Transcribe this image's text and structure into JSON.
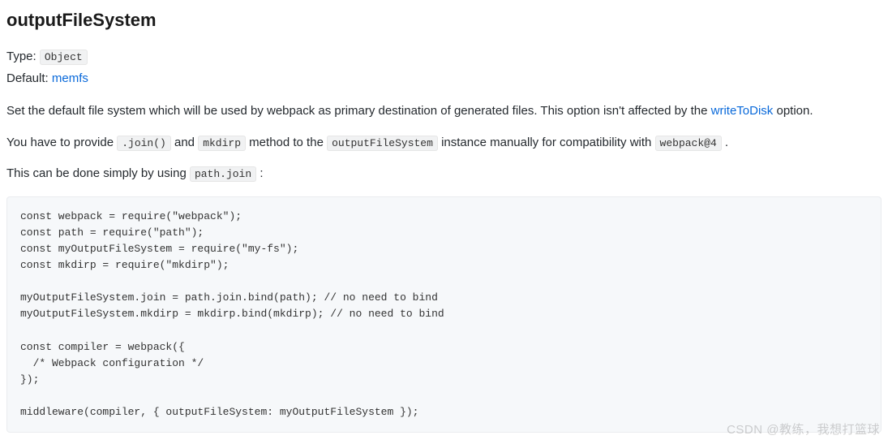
{
  "heading": "outputFileSystem",
  "meta": {
    "typeLabel": "Type: ",
    "typeValue": "Object",
    "defaultLabel": "Default: ",
    "defaultLink": "memfs"
  },
  "para1": {
    "before": "Set the default file system which will be used by webpack as primary destination of generated files. This option isn't affected by the ",
    "link": "writeToDisk",
    "after": " option."
  },
  "para2": {
    "s1": "You have to provide ",
    "c1": ".join()",
    "s2": " and ",
    "c2": "mkdirp",
    "s3": " method to the ",
    "c3": "outputFileSystem",
    "s4": " instance manually for compatibility with ",
    "c4": "webpack@4",
    "s5": " ."
  },
  "para3": {
    "s1": "This can be done simply by using ",
    "c1": "path.join",
    "s2": " :"
  },
  "code": "const webpack = require(\"webpack\");\nconst path = require(\"path\");\nconst myOutputFileSystem = require(\"my-fs\");\nconst mkdirp = require(\"mkdirp\");\n\nmyOutputFileSystem.join = path.join.bind(path); // no need to bind\nmyOutputFileSystem.mkdirp = mkdirp.bind(mkdirp); // no need to bind\n\nconst compiler = webpack({\n  /* Webpack configuration */\n});\n\nmiddleware(compiler, { outputFileSystem: myOutputFileSystem });",
  "watermark": "CSDN @教练，我想打篮球"
}
